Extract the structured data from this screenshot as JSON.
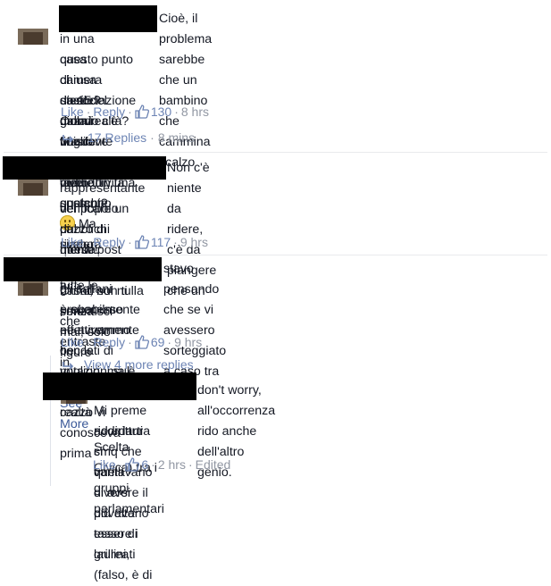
{
  "comments": [
    {
      "text_lines": [
        "Cioè, il problema sarebbe che un bambino che cammina scalzo",
        "in una casa chiusa da 15 giorni finisce con i piedi sporchi? ",
        "questo punto di dissociazione dalla realtà? Ma dove pensate di vivere, in una",
        "camera sterile? Ora vi voglio vedere quando qualcuno vi rivelerà che in tutte le",
        "case del mondo c'è una fonte di radioattività costante... "
      ],
      "line2_tail": " Ma siamo arrivati a",
      "like": "Like",
      "reply": "Reply",
      "likes": "130",
      "time": "8 hrs",
      "replies_label": "17 Replies",
      "replies_time": "8 mins"
    },
    {
      "text_lines": [
        "Non c'è niente da ridere, c'è da piangere che un",
        "rappresentante del popolo pubblichi questi post allarmisti basati sul nulla senza",
        "verificare un cazzo di niente! Complimenti Crimi, non ti smentisci mai, solo figure",
        "di merda."
      ],
      "like": "Like",
      "reply": "Reply",
      "likes": "117",
      "time": "9 hrs"
    },
    {
      "text_lines": [
        "stavo pensando che se vi avessero sorteggiato a caso tra tutti",
        "gli italiani probabilmente ne avremmo beccati di migliori, ma è quello che in realtà",
        "è successo effettivamente con le votazioni sul blog, chi cazzo vi conosceva prima",
        "che entraste in Parla..."
      ],
      "see_more": "See More",
      "like": "Like",
      "reply": "Reply",
      "likes": "69",
      "time": "9 hrs",
      "more_replies": "View 4 more replies"
    },
    {
      "text_lines": [
        "don't worry, all'occorrenza rido anche dell'altro genio.",
        "Mi preme ricordarti cmq che quelli diversi dovevano essere i grillini,",
        "addirittura si vantavano di avere il più alto tasso di laureati (falso, è di",
        "Scelta Civica) tra i gruppi parlamentari"
      ],
      "like": "Like",
      "likes": "6",
      "time": "2 hrs",
      "edited": "Edited"
    }
  ],
  "icons": [
    "thumbs-up-icon",
    "reply-arrow-icon",
    "smiley-emoji-icon"
  ],
  "colors": {
    "link": "#6d84b4",
    "meta": "#9197a3",
    "text": "#141823",
    "redaction": "#000000"
  }
}
